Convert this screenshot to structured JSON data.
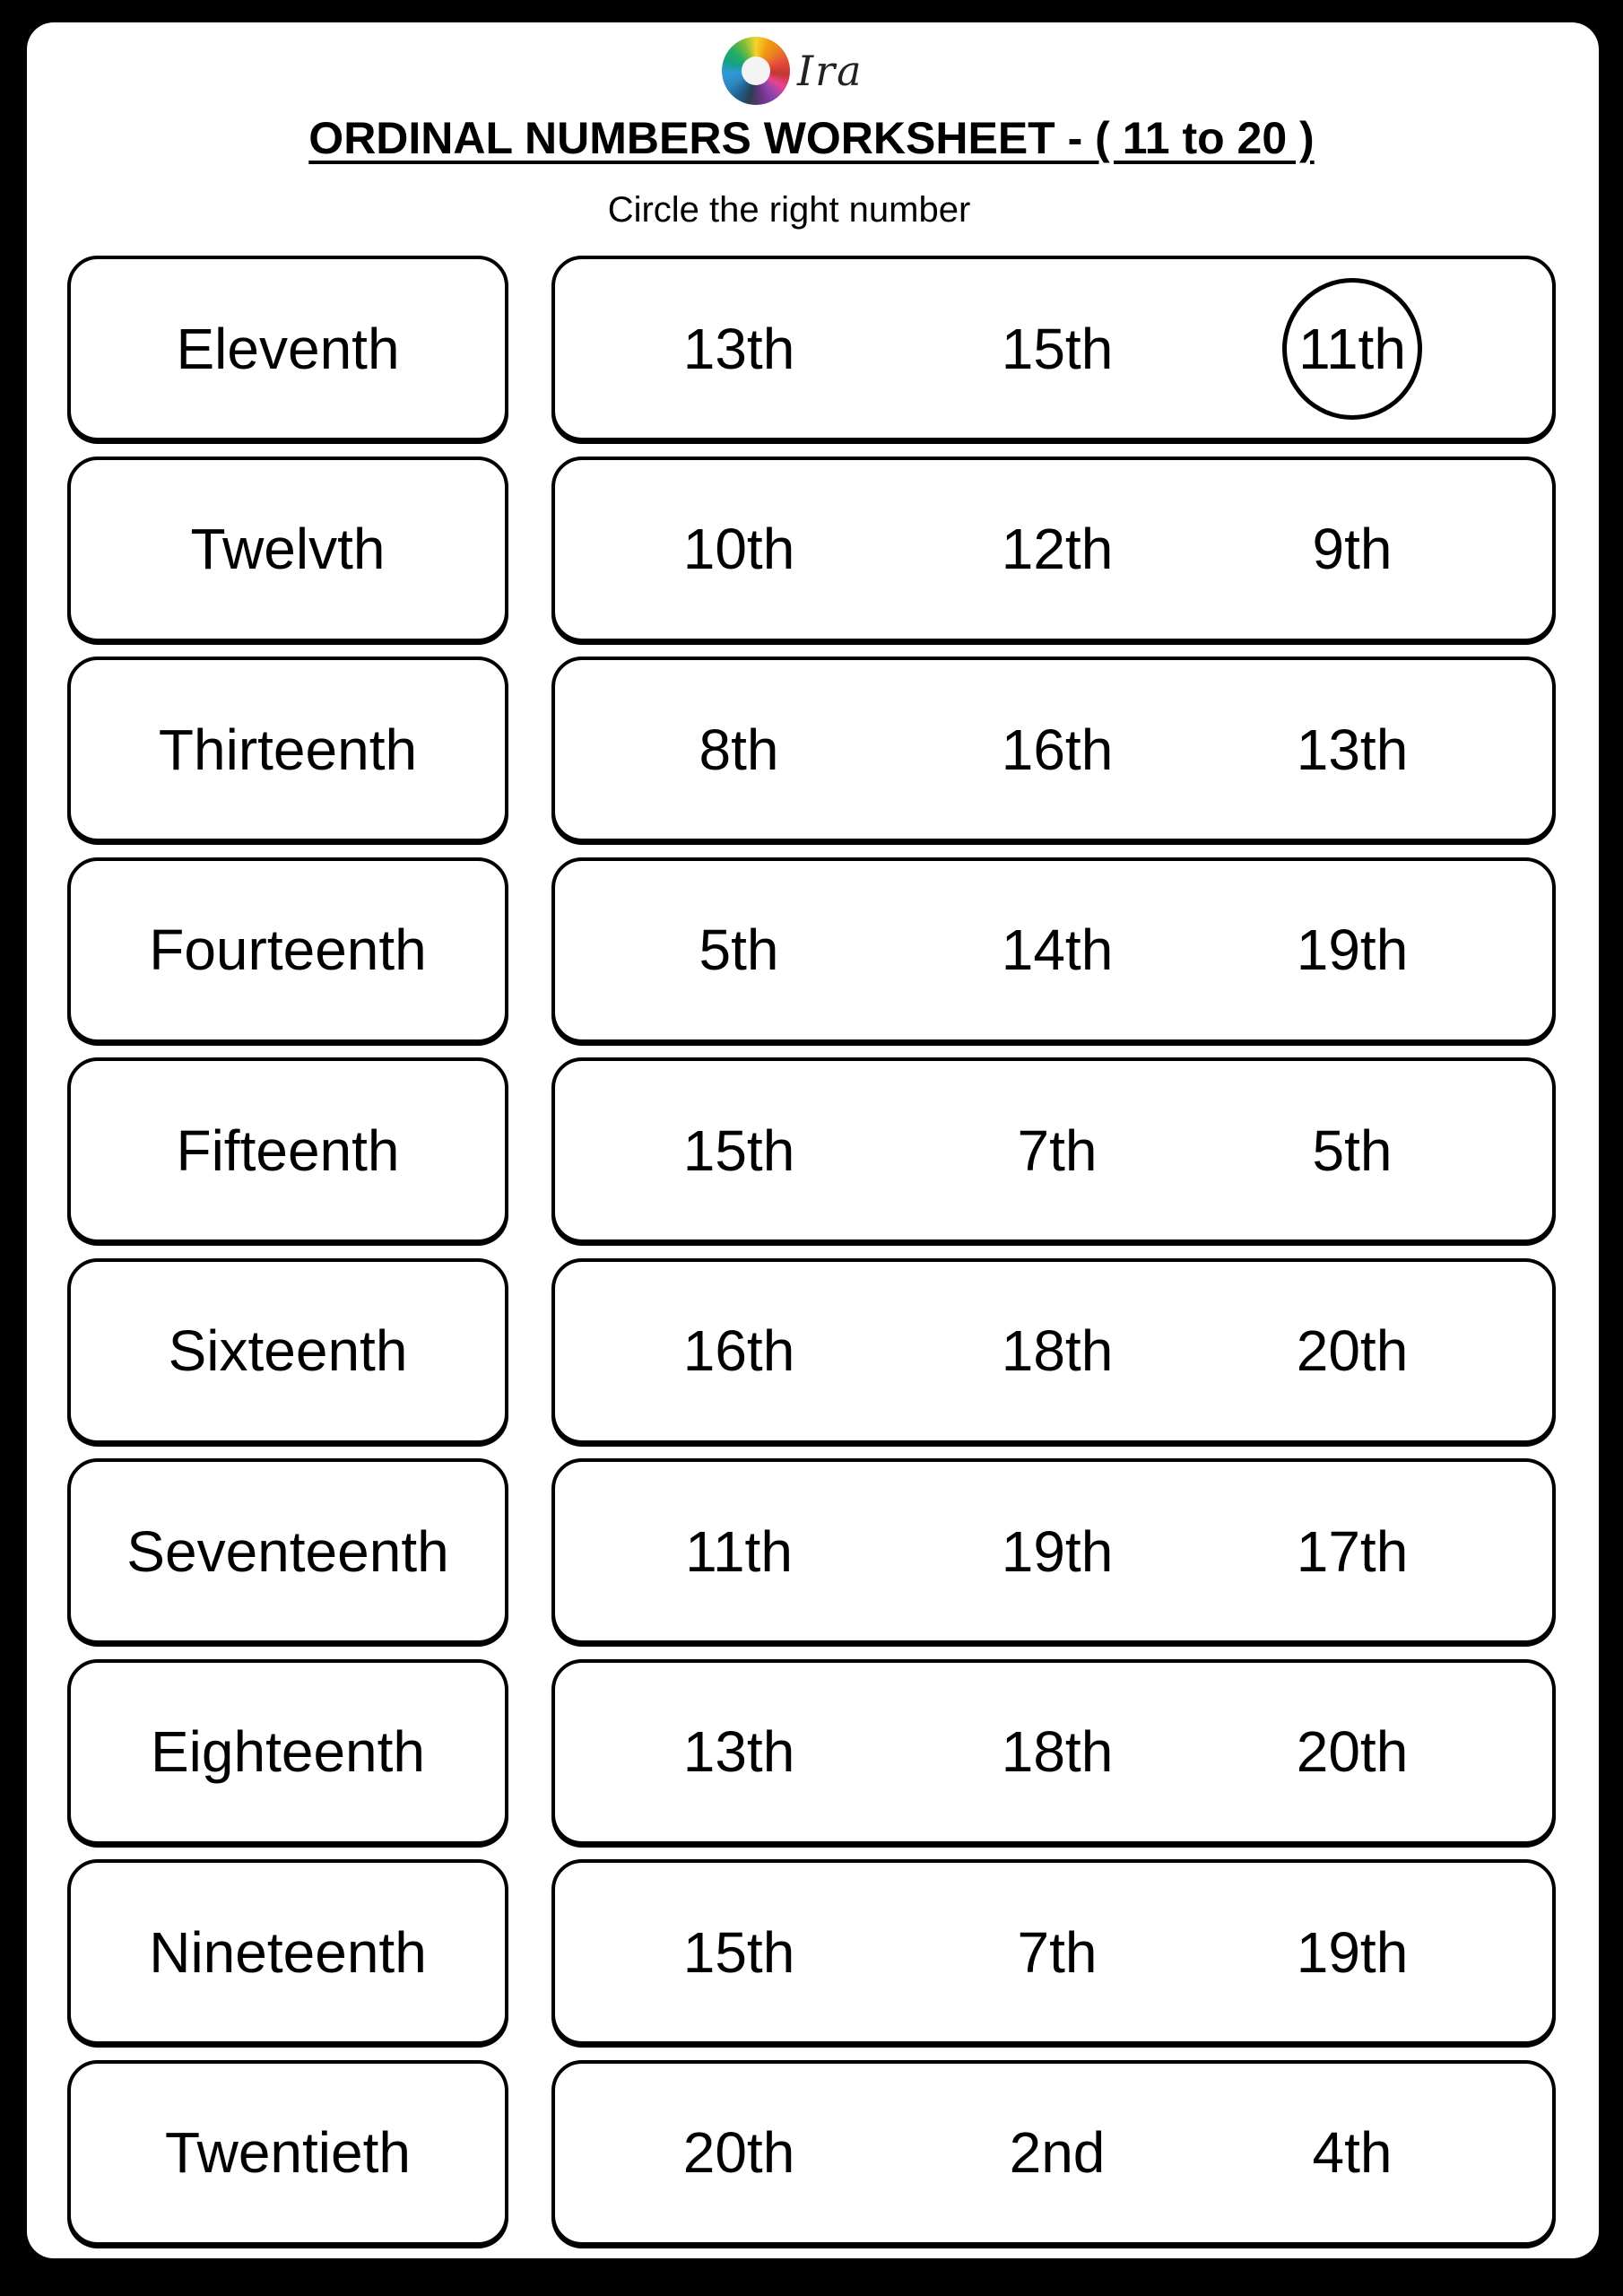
{
  "logo": {
    "brand_text": "Ira",
    "icon": "colored-pencils-wheel-icon"
  },
  "title": "ORDINAL NUMBERS WORKSHEET - ( 11 to 20 )",
  "instruction": "Circle the right number",
  "rows": [
    {
      "word": "Eleventh",
      "choices": [
        "13th",
        "15th",
        "11th"
      ],
      "circled_index": 2
    },
    {
      "word": "Twelvth",
      "choices": [
        "10th",
        "12th",
        "9th"
      ],
      "circled_index": null
    },
    {
      "word": "Thirteenth",
      "choices": [
        "8th",
        "16th",
        "13th"
      ],
      "circled_index": null
    },
    {
      "word": "Fourteenth",
      "choices": [
        "5th",
        "14th",
        "19th"
      ],
      "circled_index": null
    },
    {
      "word": "Fifteenth",
      "choices": [
        "15th",
        "7th",
        "5th"
      ],
      "circled_index": null
    },
    {
      "word": "Sixteenth",
      "choices": [
        "16th",
        "18th",
        "20th"
      ],
      "circled_index": null
    },
    {
      "word": "Seventeenth",
      "choices": [
        "11th",
        "19th",
        "17th"
      ],
      "circled_index": null
    },
    {
      "word": "Eighteenth",
      "choices": [
        "13th",
        "18th",
        "20th"
      ],
      "circled_index": null
    },
    {
      "word": "Nineteenth",
      "choices": [
        "15th",
        "7th",
        "19th"
      ],
      "circled_index": null
    },
    {
      "word": "Twentieth",
      "choices": [
        "20th",
        "2nd",
        "4th"
      ],
      "circled_index": null
    }
  ]
}
